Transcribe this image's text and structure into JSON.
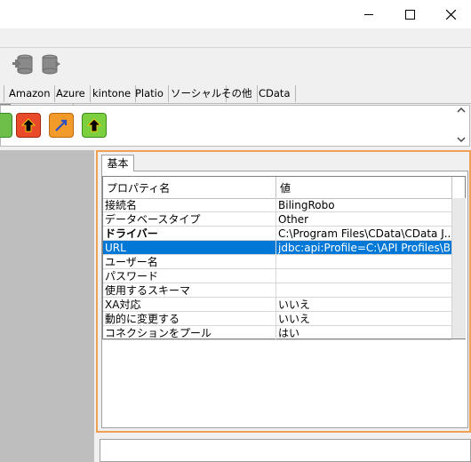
{
  "window": {
    "minimize_icon": "minimize-icon",
    "maximize_icon": "maximize-icon",
    "close_icon": "close-icon"
  },
  "category_tabs": [
    "Amazon",
    "Azure",
    "kintone",
    "Platio",
    "ソーシャル",
    "その他",
    "CData"
  ],
  "property_panel": {
    "tab_label": "基本",
    "header": {
      "name": "プロパティ名",
      "value": "値"
    },
    "rows": [
      {
        "name": "接続名",
        "value": "BilingRobo"
      },
      {
        "name": "データベースタイプ",
        "value": "Other"
      },
      {
        "name": "ドライバー",
        "value": "C:\\Program Files\\CData\\CData J..."
      },
      {
        "name": "URL",
        "value": "jdbc:api:Profile=C:\\API Profiles\\Bil..."
      },
      {
        "name": "ユーザー名",
        "value": ""
      },
      {
        "name": "パスワード",
        "value": ""
      },
      {
        "name": "使用するスキーマ",
        "value": ""
      },
      {
        "name": "XA対応",
        "value": "いいえ"
      },
      {
        "name": "動的に変更する",
        "value": "いいえ"
      },
      {
        "name": "コネクションをプール",
        "value": "はい"
      }
    ]
  },
  "colors": {
    "selection": "#0078d7",
    "panel_border": "#f0a055"
  }
}
